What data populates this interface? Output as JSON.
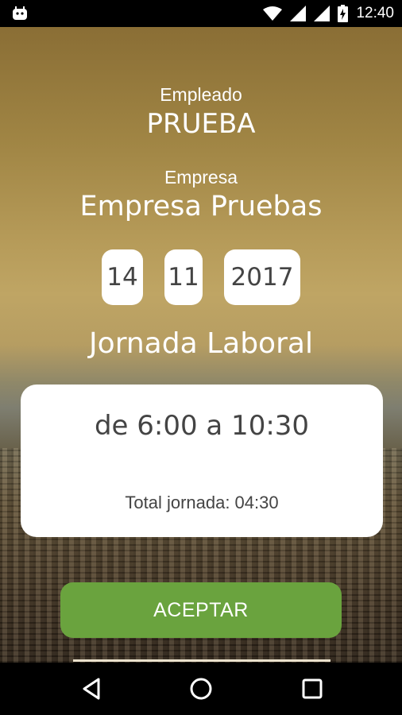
{
  "status_bar": {
    "time": "12:40",
    "icons": [
      "android-notification-icon",
      "wifi-icon",
      "signal-icon",
      "signal-icon",
      "battery-charging-icon"
    ]
  },
  "employee": {
    "label": "Empleado",
    "name": "PRUEBA"
  },
  "company": {
    "label": "Empresa",
    "name": "Empresa Pruebas"
  },
  "date": {
    "day": "14",
    "month": "11",
    "year": "2017"
  },
  "jornada": {
    "title": "Jornada Laboral",
    "hours": "de 6:00 a 10:30",
    "total": "Total jornada: 04:30"
  },
  "accept_label": "ACEPTAR",
  "colors": {
    "accent": "#6aa33e",
    "text_dark": "#444444"
  },
  "nav_bar": {
    "icons": [
      "back-icon",
      "home-icon",
      "recent-apps-icon"
    ]
  }
}
